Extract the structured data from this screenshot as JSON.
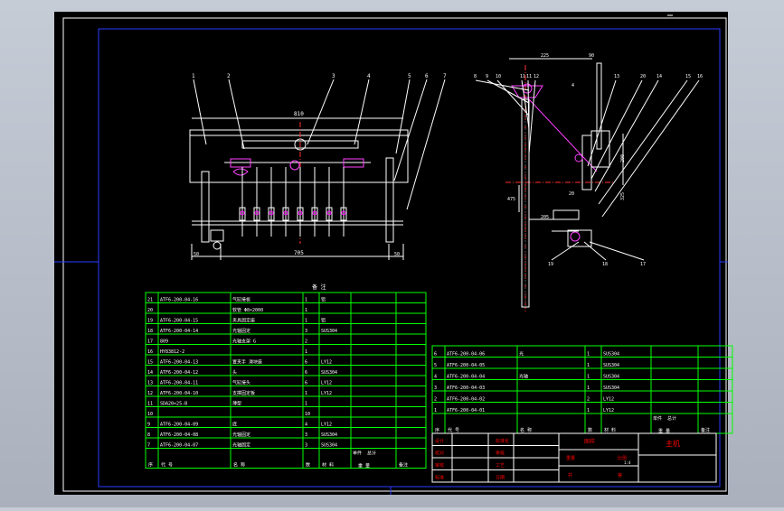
{
  "colors": {
    "background": "#000000",
    "frame": "#ffffff",
    "inner_border": "#0000ff",
    "outline": "#ffffff",
    "part": "#ff00ff",
    "centerline": "#ff0000",
    "table": "#00ff00",
    "text": "#ffffff",
    "title_block_accent": "#ff0000",
    "balloon_text": "#ffff00"
  },
  "front_view": {
    "balloons": [
      "1",
      "2",
      "3",
      "4",
      "5",
      "6",
      "7"
    ],
    "dims": {
      "overall_width": "810",
      "left_offset": "50",
      "span": "705",
      "right_offset": "50"
    }
  },
  "side_view": {
    "balloons_top": [
      "8",
      "9",
      "10",
      "11",
      "11",
      "12",
      "13",
      "20",
      "14",
      "15",
      "16"
    ],
    "balloons_bottom": [
      "19",
      "18",
      "17"
    ],
    "mark_4": "4",
    "dims": {
      "top": "225",
      "top_right": "90",
      "right_mid": "200",
      "right_low": "325",
      "left": "475",
      "lower": "205",
      "marker_20": "20"
    }
  },
  "left_bom_title": "备 注",
  "left_bom": [
    {
      "no": "21",
      "code": "ATF6-200-04-16",
      "name": "气缸接板",
      "qty": "1",
      "mat": "铝"
    },
    {
      "no": "20",
      "code": "",
      "name": "软管 Φ8×2000",
      "qty": "1",
      "mat": ""
    },
    {
      "no": "19",
      "code": "ATF6-200-04-15",
      "name": "夹具固定座",
      "qty": "1",
      "mat": "铝"
    },
    {
      "no": "18",
      "code": "ATF6-200-04-14",
      "name": "光轴固定",
      "qty": "3",
      "mat": "SUS304"
    },
    {
      "no": "17",
      "code": "809",
      "name": "光轴支架 G",
      "qty": "2",
      "mat": ""
    },
    {
      "no": "16",
      "code": "HY83812-2",
      "name": "",
      "qty": "1",
      "mat": ""
    },
    {
      "no": "15",
      "code": "ATF6-200-04-13",
      "name": "置夹手 滑块座",
      "qty": "6",
      "mat": "LY12"
    },
    {
      "no": "14",
      "code": "ATF6-200-04-12",
      "name": "头",
      "qty": "6",
      "mat": "SUS304"
    },
    {
      "no": "13",
      "code": "ATF6-200-04-11",
      "name": "气缸接头",
      "qty": "6",
      "mat": "LY12"
    },
    {
      "no": "12",
      "code": "ATF6-200-04-10",
      "name": "支撑固定板",
      "qty": "1",
      "mat": "LY12"
    },
    {
      "no": "11",
      "code": "SDA20×25-B",
      "name": "薄型",
      "qty": "1",
      "mat": ""
    },
    {
      "no": "10",
      "code": "",
      "name": "",
      "qty": "10",
      "mat": ""
    },
    {
      "no": "9",
      "code": "ATF6-200-04-09",
      "name": "底",
      "qty": "4",
      "mat": "LY12"
    },
    {
      "no": "8",
      "code": "ATF6-200-04-08",
      "name": "光轴固定",
      "qty": "3",
      "mat": "SUS304"
    },
    {
      "no": "7",
      "code": "ATF6-200-04-07",
      "name": "光轴固定",
      "qty": "3",
      "mat": "SUS304"
    }
  ],
  "left_bom_header": {
    "no": "序",
    "code": "代 号",
    "name": "名 称",
    "qty": "数",
    "mat": "材 料",
    "single": "单件",
    "total": "总计",
    "weight": "重 量",
    "note": "备注"
  },
  "right_bom": [
    {
      "no": "6",
      "code": "ATF6-200-04-06",
      "name": "光",
      "qty": "1",
      "mat": "SUS304"
    },
    {
      "no": "5",
      "code": "ATF6-200-04-05",
      "name": "",
      "qty": "1",
      "mat": "SUS304"
    },
    {
      "no": "4",
      "code": "ATF6-200-04-04",
      "name": "光轴",
      "qty": "1",
      "mat": "SUS304"
    },
    {
      "no": "3",
      "code": "ATF6-200-04-03",
      "name": "",
      "qty": "1",
      "mat": "SUS304"
    },
    {
      "no": "2",
      "code": "ATF6-200-04-02",
      "name": "",
      "qty": "2",
      "mat": "LY12"
    },
    {
      "no": "1",
      "code": "ATF6-200-04-01",
      "name": "",
      "qty": "1",
      "mat": "LY12"
    }
  ],
  "right_bom_header": {
    "no": "序",
    "code": "代 号",
    "name": "名 称",
    "qty": "数",
    "mat": "材 料",
    "single": "单件",
    "total": "总计",
    "weight": "重 量",
    "note": "备注"
  },
  "title_block": {
    "rows": [
      [
        "设计",
        "标准化"
      ],
      [
        "校对",
        "审核"
      ],
      [
        "审核",
        "工艺"
      ],
      [
        "标准",
        "日期"
      ]
    ],
    "stage_label": "图样",
    "weight": "重量",
    "scale": "比例",
    "drawing_name": "主机",
    "sheet": "共",
    "page": "第",
    "scale_value": "1:4"
  }
}
